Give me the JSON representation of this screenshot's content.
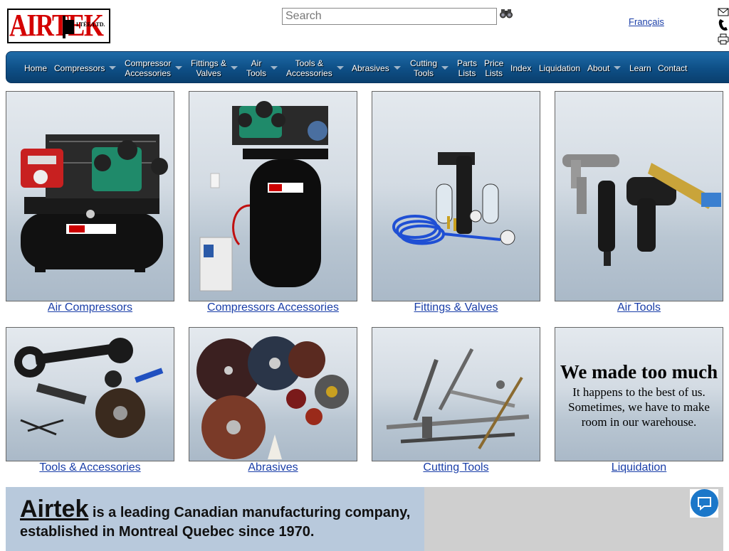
{
  "header": {
    "logo_text": "AIRTEK",
    "logo_sub": "LTÉE/LTD.",
    "search_placeholder": "Search",
    "language_link": "Français"
  },
  "nav": {
    "items": [
      {
        "label": "Home",
        "dropdown": false
      },
      {
        "label": "Compressors",
        "dropdown": true
      },
      {
        "label": "Compressor\nAccessories",
        "dropdown": true
      },
      {
        "label": "Fittings &\nValves",
        "dropdown": true
      },
      {
        "label": "Air\nTools",
        "dropdown": true
      },
      {
        "label": "Tools &\nAccessories",
        "dropdown": true
      },
      {
        "label": "Abrasives",
        "dropdown": true
      },
      {
        "label": "Cutting\nTools",
        "dropdown": true
      },
      {
        "label": "Parts\nLists",
        "dropdown": false
      },
      {
        "label": "Price\nLists",
        "dropdown": false
      },
      {
        "label": "Index",
        "dropdown": false
      },
      {
        "label": "Liquidation",
        "dropdown": false
      },
      {
        "label": "About",
        "dropdown": true
      },
      {
        "label": "Learn",
        "dropdown": false
      },
      {
        "label": "Contact",
        "dropdown": false
      }
    ]
  },
  "categories": [
    {
      "caption": "Air Compressors",
      "image": "air-compressor-image"
    },
    {
      "caption": "Compressors Accessories",
      "image": "vertical-tank-compressor-image"
    },
    {
      "caption": "Fittings & Valves",
      "image": "filter-regulator-hose-image"
    },
    {
      "caption": "Air Tools",
      "image": "pneumatic-tools-image"
    },
    {
      "caption": "Tools & Accessories",
      "image": "wrenches-and-brushes-image"
    },
    {
      "caption": "Abrasives",
      "image": "grinding-discs-image"
    },
    {
      "caption": "Cutting Tools",
      "image": "drill-bits-reamers-image"
    },
    {
      "caption": "Liquidation",
      "image": "liquidation-text-tile"
    }
  ],
  "liquidation_tile": {
    "heading": "We made too much",
    "body": "It happens to the best of us. Sometimes, we have to make room in our warehouse."
  },
  "about": {
    "brand": "Airtek",
    "text": " is a leading Canadian manufacturing company, established in Montreal Quebec since 1970."
  },
  "colors": {
    "nav_blue": "#0e4f86",
    "link_blue": "#1a3ea8",
    "logo_red": "#d40000",
    "about_bg": "#b8c9dc",
    "chat_blue": "#1b77c9"
  }
}
